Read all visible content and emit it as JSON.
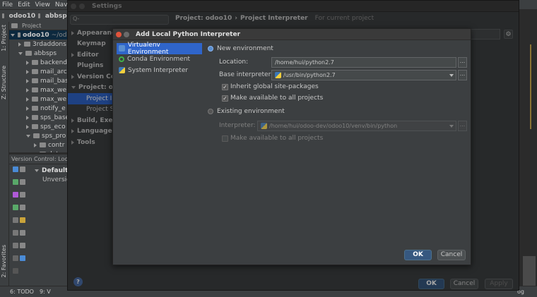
{
  "menubar": {
    "items": [
      "File",
      "Edit",
      "View",
      "Navi"
    ]
  },
  "navbar": {
    "crumbs": [
      "odoo10",
      "abbsps"
    ]
  },
  "leftstrip": {
    "tabs": [
      "1: Project",
      "Z: Structure",
      "2: Favorites"
    ]
  },
  "project_panel": {
    "header": "Project",
    "items": [
      {
        "label": "odoo10",
        "suffix": "~/odo",
        "level": 0,
        "expanded": true,
        "bold": true
      },
      {
        "label": "3rdaddons",
        "level": 1
      },
      {
        "label": "abbsps",
        "level": 1,
        "expanded": true
      },
      {
        "label": "backend",
        "level": 2
      },
      {
        "label": "mail_arc",
        "level": 2
      },
      {
        "label": "mail_bas",
        "level": 2
      },
      {
        "label": "max_we",
        "level": 2
      },
      {
        "label": "max_we",
        "level": 2
      },
      {
        "label": "notify_e",
        "level": 2
      },
      {
        "label": "sps_base",
        "level": 2
      },
      {
        "label": "sps_eco",
        "level": 2
      },
      {
        "label": "sps_pro",
        "level": 2,
        "expanded": true
      },
      {
        "label": "contr",
        "level": 3
      },
      {
        "label": "data",
        "level": 3
      }
    ]
  },
  "vc_panel": {
    "header": "Version Control:",
    "tab": "Loc",
    "default_label": "Default",
    "unversioned_label": "Unversio"
  },
  "statusbar": {
    "todo": "6: TODO",
    "vc": "9: V",
    "right": "og"
  },
  "settings": {
    "title": "Settings",
    "search_placeholder": "Q-",
    "tree": [
      {
        "label": "Appearance",
        "type": "top"
      },
      {
        "label": "Keymap",
        "type": "top"
      },
      {
        "label": "Editor",
        "type": "top"
      },
      {
        "label": "Plugins",
        "type": "top"
      },
      {
        "label": "Version Co",
        "type": "top"
      },
      {
        "label": "Project: od",
        "type": "top"
      },
      {
        "label": "Project In",
        "type": "sub",
        "selected": true
      },
      {
        "label": "Project St",
        "type": "sub"
      },
      {
        "label": "Build, Exec",
        "type": "top"
      },
      {
        "label": "Languages",
        "type": "top"
      },
      {
        "label": "Tools",
        "type": "top"
      }
    ],
    "header": {
      "project": "Project: odoo10",
      "separator": "›",
      "page": "Project Interpreter",
      "scope": "For current project"
    },
    "buttons": {
      "ok": "OK",
      "cancel": "Cancel",
      "apply": "Apply"
    },
    "help": "?"
  },
  "dialog": {
    "title": "Add Local Python Interpreter",
    "types": [
      {
        "label": "Virtualenv Environment",
        "icon": "virtualenv-icon",
        "selected": true
      },
      {
        "label": "Conda Environment",
        "icon": "conda-icon"
      },
      {
        "label": "System Interpreter",
        "icon": "python-icon"
      }
    ],
    "new_env": {
      "label": "New environment",
      "location_label": "Location:",
      "location_value": "/home/hui/python2.7",
      "base_label": "Base interpreter:",
      "base_value": "/usr/bin/python2.7",
      "inherit_label": "Inherit global site-packages",
      "make_avail_label": "Make available to all projects"
    },
    "existing_env": {
      "label": "Existing environment",
      "interpreter_label": "Interpreter:",
      "interpreter_value": "/home/hui/odoo-dev/odoo10/venv/bin/python",
      "make_avail_label": "Make available to all projects"
    },
    "browse": "...",
    "checkmark": "✓",
    "buttons": {
      "ok": "OK",
      "cancel": "Cancel"
    }
  }
}
